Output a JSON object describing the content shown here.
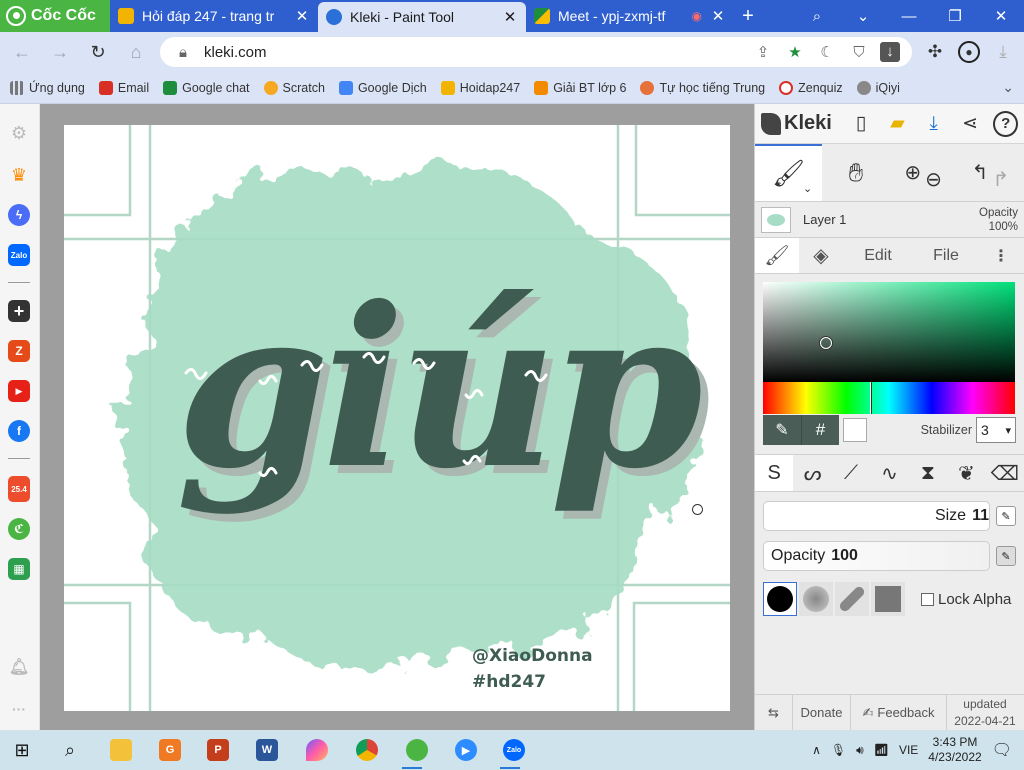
{
  "browser": {
    "brand": "Cốc Cốc",
    "tabs": [
      {
        "title": "Hỏi đáp 247 - trang tr",
        "icon": "hoidap-icon",
        "color": "#f2b400",
        "active": false
      },
      {
        "title": "Kleki - Paint Tool",
        "icon": "kleki-icon",
        "color": "#2b6fd8",
        "active": true
      },
      {
        "title": "Meet - ypj-zxmj-tf",
        "icon": "meet-icon",
        "color": "#1e8e3e",
        "active": false
      }
    ],
    "url": "kleki.com"
  },
  "bookmarks": [
    {
      "label": "Ứng dụng",
      "color": "#777"
    },
    {
      "label": "Email",
      "color": "#d93025"
    },
    {
      "label": "Google chat",
      "color": "#1e8e3e"
    },
    {
      "label": "Scratch",
      "color": "#f7a823"
    },
    {
      "label": "Google Dịch",
      "color": "#4285f4"
    },
    {
      "label": "Hoidap247",
      "color": "#f2b400"
    },
    {
      "label": "Giải BT lớp 6",
      "color": "#f28b00"
    },
    {
      "label": "Tự học tiếng Trung",
      "color": "#e8713a"
    },
    {
      "label": "Zenquiz",
      "color": "#d93025"
    },
    {
      "label": "iQiyi",
      "color": "#555"
    }
  ],
  "artwork": {
    "word": "giúp",
    "credit": "@XiaoDonna",
    "hashtag": "#hd247",
    "blob_color": "#a6dcc4",
    "text_color": "#3f5c52",
    "shadow_color": "#aab8b1",
    "guide_color": "#b3d6c6"
  },
  "kleki": {
    "logo": "Kleki",
    "layer": {
      "name": "Layer 1",
      "opacity_label": "Opacity",
      "opacity_value": "100%"
    },
    "tabs": {
      "edit": "Edit",
      "file": "File"
    },
    "color": {
      "hash": "#",
      "stabilizer_label": "Stabilizer",
      "stabilizer_value": "3"
    },
    "size": {
      "label": "Size",
      "value": "11",
      "fill": 0.9
    },
    "opacity": {
      "label": "Opacity",
      "value": "100",
      "fill": 1.0
    },
    "lock_alpha": "Lock Alpha",
    "footer": {
      "donate": "Donate",
      "feedback": "Feedback",
      "updated_label": "updated",
      "updated_date": "2022-04-21"
    }
  },
  "taskbar": {
    "language": "VIE",
    "time": "3:43 PM",
    "date": "4/23/2022"
  }
}
